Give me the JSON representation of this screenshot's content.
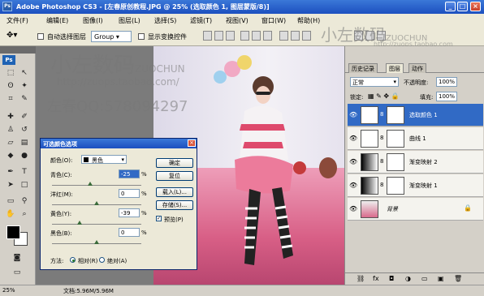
{
  "window": {
    "app_icon": "Ps",
    "title": "Adobe Photoshop CS3 - [左春原创教程.JPG @ 25% (选取颜色 1, 图层蒙版/8)]",
    "min": "_",
    "max": "□",
    "close": "×"
  },
  "menu": [
    "文件(F)",
    "编辑(E)",
    "图像(I)",
    "图层(L)",
    "选择(S)",
    "滤镜(T)",
    "视图(V)",
    "窗口(W)",
    "帮助(H)"
  ],
  "options": {
    "auto_select_label": "自动选择图层",
    "auto_select_mode": "Group",
    "show_transform_label": "显示变换控件"
  },
  "toolbox": {
    "ps_label": "Ps"
  },
  "watermarks": {
    "brand_cn": "小左数码",
    "brand_en": "ZUOCHUN",
    "url": "http://zuops.taobao.com/",
    "qq": "左春QQ:578094297",
    "top_brand_cn": "小左数码",
    "top_brand_en": "ZUOCHUN",
    "top_url": "http://zuops.taobao.com"
  },
  "dialog": {
    "title": "可选颜色选项",
    "color_label": "颜色(O):",
    "color_value": "黑色",
    "sliders": [
      {
        "label": "青色(C):",
        "value": "-25",
        "unit": "%",
        "level": 0.43
      },
      {
        "label": "洋红(M):",
        "value": "0",
        "unit": "%",
        "level": 0.5
      },
      {
        "label": "黄色(Y):",
        "value": "-39",
        "unit": "%",
        "level": 0.31
      },
      {
        "label": "黑色(B):",
        "value": "0",
        "unit": "%",
        "level": 0.5
      }
    ],
    "buttons": {
      "ok": "确定",
      "reset": "复位",
      "load": "载入(L)...",
      "save": "存储(S)..."
    },
    "preview_label": "预览(P)",
    "method_label": "方法:",
    "method_relative": "相对(R)",
    "method_absolute": "绝对(A)"
  },
  "layers_panel": {
    "tabs": [
      "历史记录",
      "图层",
      "动作"
    ],
    "blend_mode": "正常",
    "opacity_label": "不透明度:",
    "opacity_value": "100%",
    "lock_label": "锁定:",
    "fill_label": "填充:",
    "fill_value": "100%",
    "layers": [
      {
        "name": "选取颜色 1",
        "selected": true
      },
      {
        "name": "曲线 1",
        "selected": false
      },
      {
        "name": "渐变映射 2",
        "selected": false
      },
      {
        "name": "渐变映射 1",
        "selected": false
      },
      {
        "name": "背景",
        "selected": false
      }
    ]
  },
  "status": {
    "zoom": "25%",
    "doc": "文档:5.96M/5.96M"
  }
}
